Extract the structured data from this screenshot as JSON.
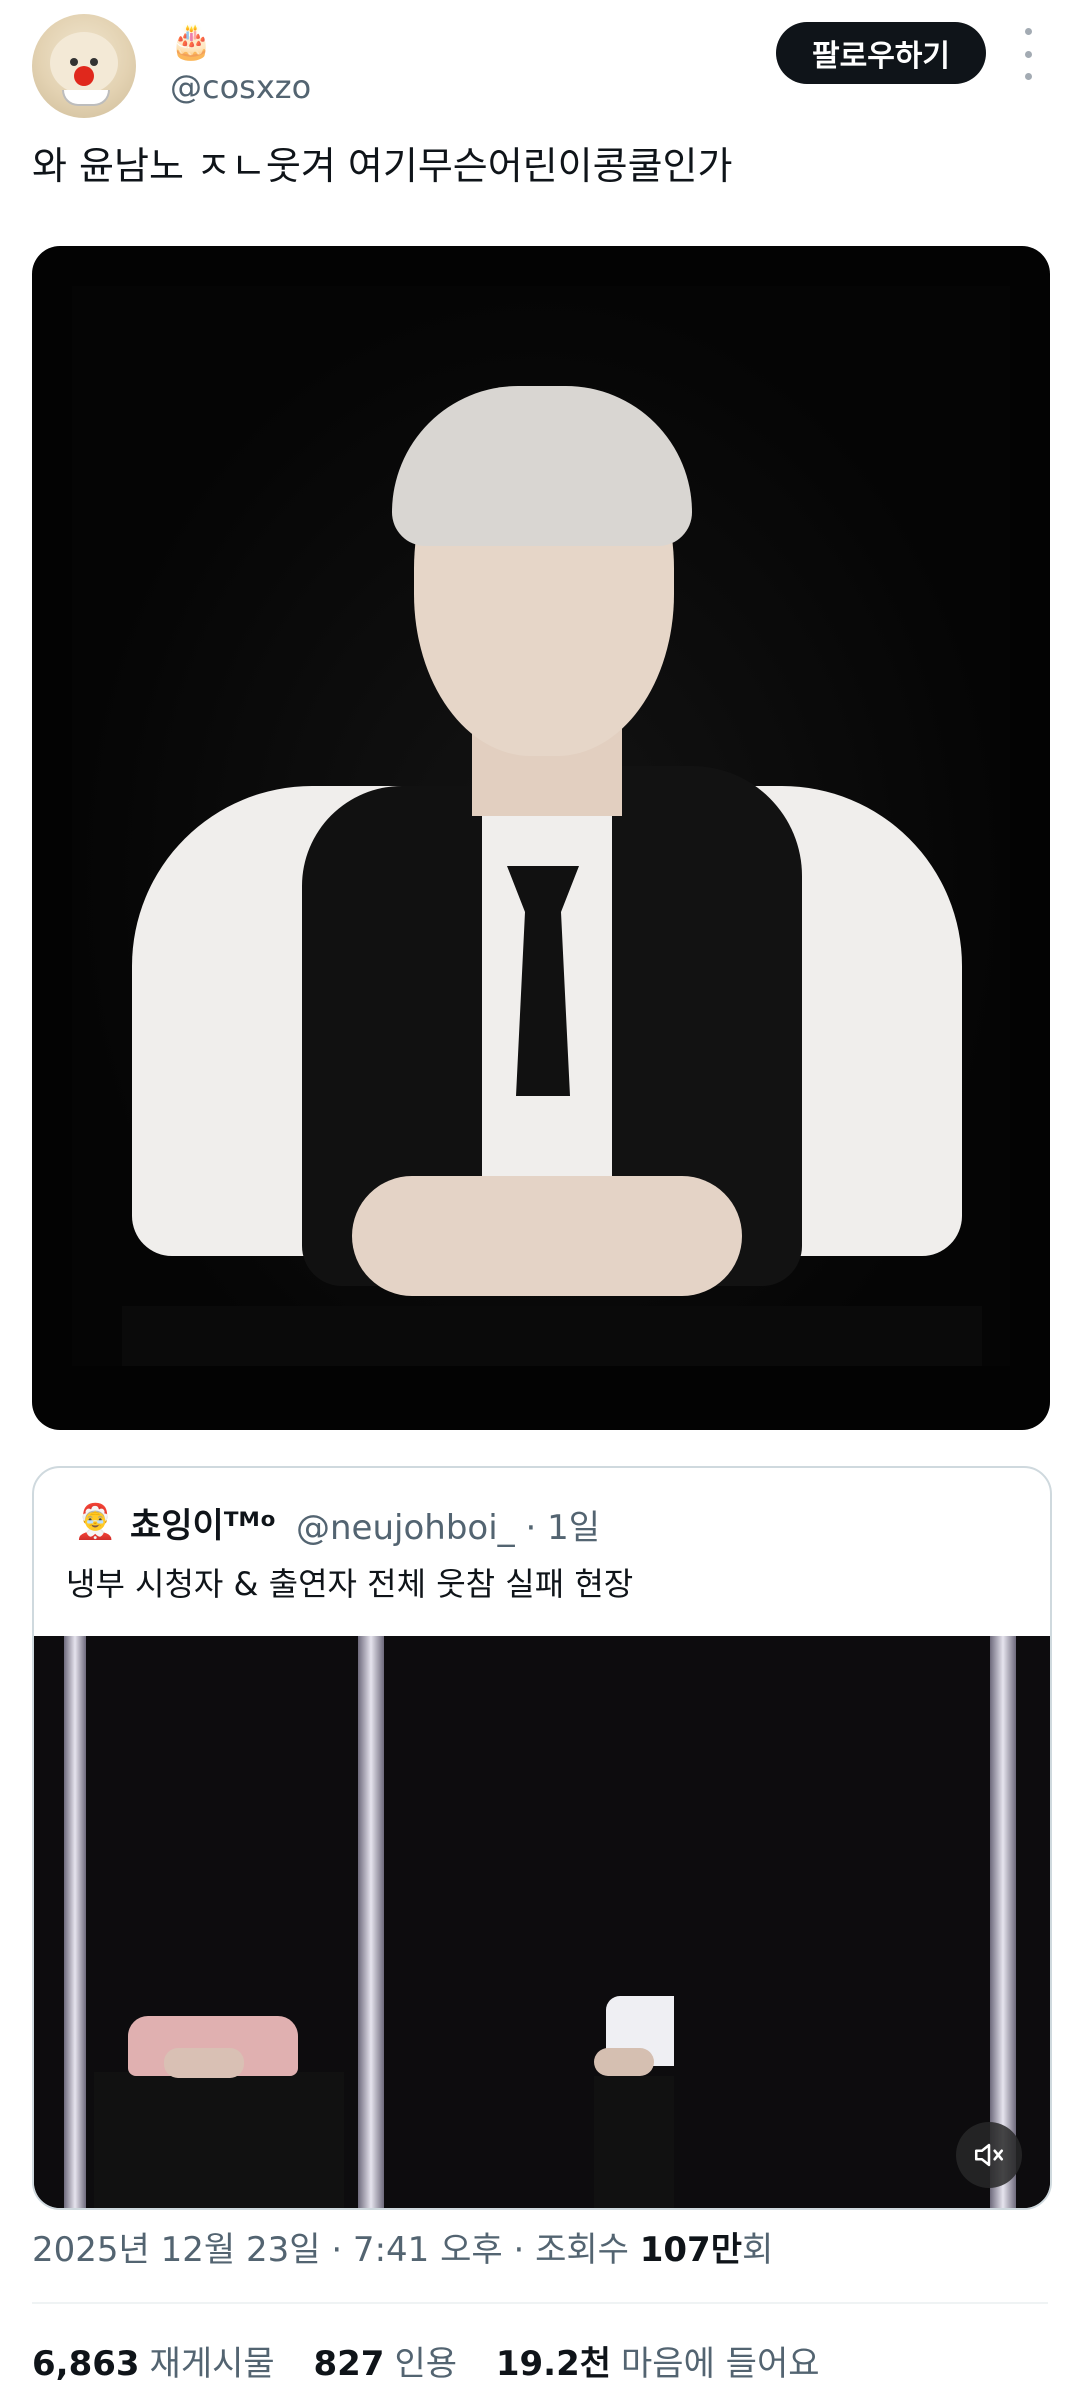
{
  "author": {
    "badge_emoji": "🎂",
    "handle": "@cosxzo",
    "follow_label": "팔로우하기"
  },
  "tweet": {
    "text": "와 윤남노 ㅈㄴ웃겨 여기무슨어린이콩쿨인가"
  },
  "quote": {
    "avatar_emoji": "🤶",
    "name": "쵸잉이ᵀᴹᵒ",
    "handle_time": "@neujohboi_ · 1일",
    "text": "냉부 시청자 & 출연자 전체 웃참 실패 현장"
  },
  "meta": {
    "date_time": "2025년 12월 23일 · 7:41 오후 · 조회수 ",
    "views_number": "107만",
    "views_suffix": "회"
  },
  "stats": {
    "reposts_count": "6,863",
    "reposts_label": "재게시물",
    "quotes_count": "827",
    "quotes_label": "인용",
    "likes_count": "19.2천",
    "likes_label": "마음에 들어요"
  },
  "icons": {
    "mute": "speaker-muted-icon",
    "more": "more-vertical-icon"
  }
}
